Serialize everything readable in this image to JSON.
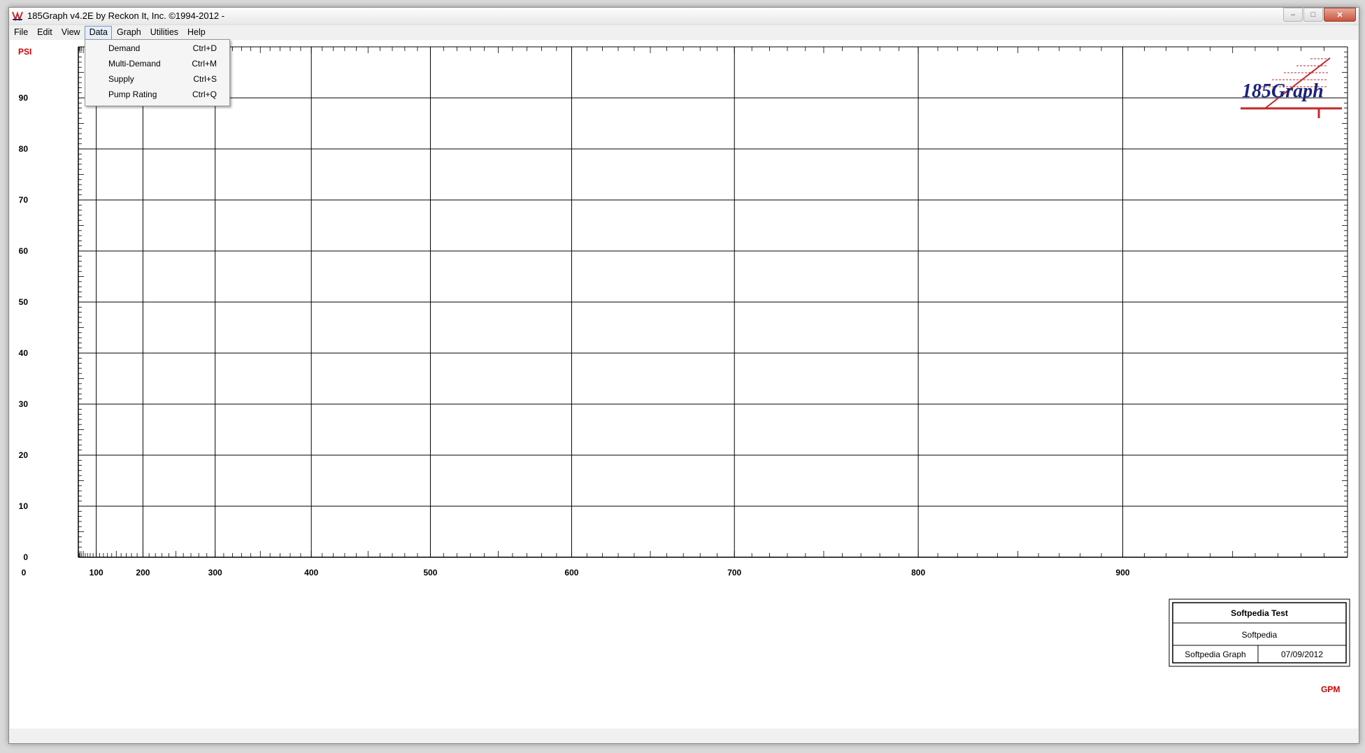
{
  "window": {
    "title": "185Graph v4.2E by Reckon It, Inc. ©1994-2012 -",
    "min_label": "–",
    "max_label": "□",
    "close_label": "✕"
  },
  "menu": [
    "File",
    "Edit",
    "View",
    "Data",
    "Graph",
    "Utilities",
    "Help"
  ],
  "active_menu": "Data",
  "data_menu": [
    {
      "label": "Demand",
      "shortcut": "Ctrl+D"
    },
    {
      "label": "Multi-Demand",
      "shortcut": "Ctrl+M"
    },
    {
      "label": "Supply",
      "shortcut": "Ctrl+S"
    },
    {
      "label": "Pump Rating",
      "shortcut": "Ctrl+Q"
    }
  ],
  "graph": {
    "y_unit": "PSI",
    "x_unit": "GPM",
    "y_ticks": [
      "90",
      "80",
      "70",
      "60",
      "50",
      "40",
      "30",
      "20",
      "10",
      "0"
    ],
    "x_ticks": [
      "0",
      "100",
      "200",
      "300",
      "400",
      "500",
      "600",
      "700",
      "800",
      "900"
    ],
    "logo_text": "185Graph",
    "colors": {
      "unit_label": "#cc0000",
      "logo_text": "#1a237e",
      "logo_lines": "#c62828",
      "grid": "#000000"
    }
  },
  "title_block": {
    "title": "Softpedia Test",
    "subtitle": "Softpedia",
    "graph_name": "Softpedia Graph",
    "date": "07/09/2012"
  }
}
